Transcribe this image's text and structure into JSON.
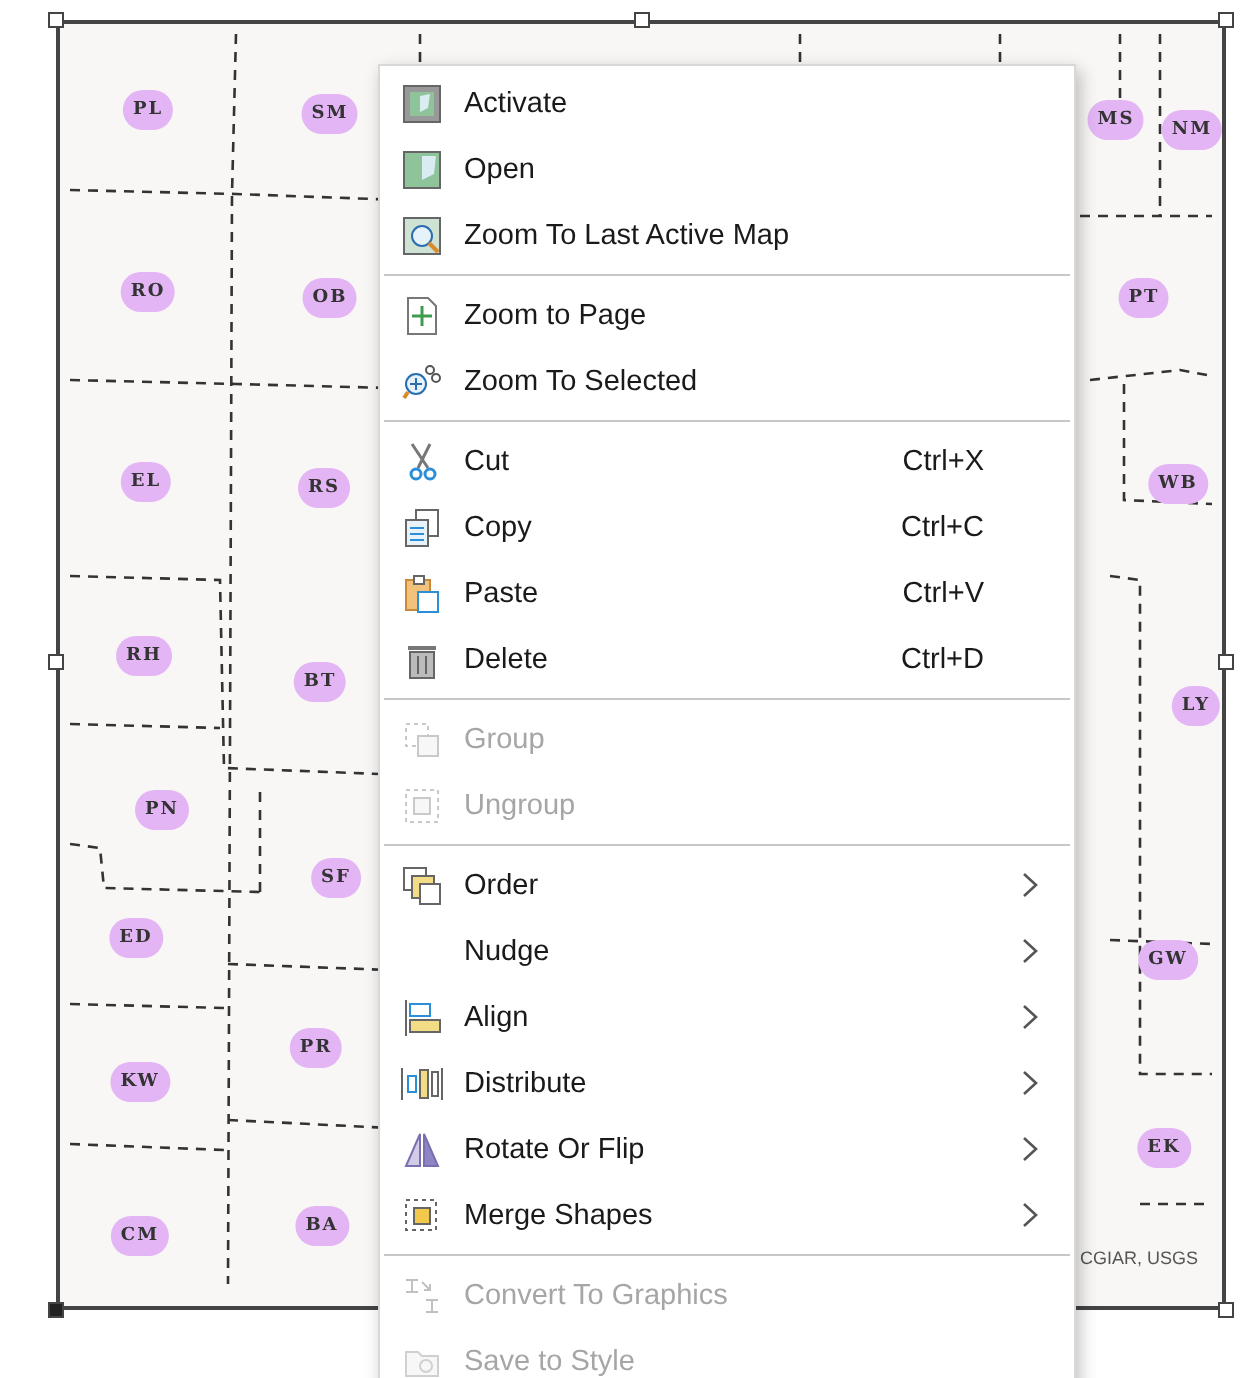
{
  "map": {
    "labels": [
      "PL",
      "SM",
      "MS",
      "NM",
      "RO",
      "OB",
      "PT",
      "EL",
      "RS",
      "WB",
      "RH",
      "BT",
      "LY",
      "PN",
      "SF",
      "ED",
      "GW",
      "PR",
      "KW",
      "EK",
      "CM",
      "BA"
    ],
    "attribution": "CGIAR, USGS"
  },
  "context_menu": {
    "sections": [
      [
        {
          "label": "Activate",
          "disabled": false,
          "submenu": false
        },
        {
          "label": "Open",
          "disabled": false,
          "submenu": false
        },
        {
          "label": "Zoom To Last Active Map",
          "disabled": false,
          "submenu": false
        }
      ],
      [
        {
          "label": "Zoom to Page",
          "disabled": false,
          "submenu": false
        },
        {
          "label": "Zoom To Selected",
          "disabled": false,
          "submenu": false
        }
      ],
      [
        {
          "label": "Cut",
          "shortcut": "Ctrl+X",
          "disabled": false,
          "submenu": false
        },
        {
          "label": "Copy",
          "shortcut": "Ctrl+C",
          "disabled": false,
          "submenu": false
        },
        {
          "label": "Paste",
          "shortcut": "Ctrl+V",
          "disabled": false,
          "submenu": false
        },
        {
          "label": "Delete",
          "shortcut": "Ctrl+D",
          "disabled": false,
          "submenu": false
        }
      ],
      [
        {
          "label": "Group",
          "disabled": true,
          "submenu": false
        },
        {
          "label": "Ungroup",
          "disabled": true,
          "submenu": false
        }
      ],
      [
        {
          "label": "Order",
          "disabled": false,
          "submenu": true
        },
        {
          "label": "Nudge",
          "disabled": false,
          "submenu": true
        },
        {
          "label": "Align",
          "disabled": false,
          "submenu": true
        },
        {
          "label": "Distribute",
          "disabled": false,
          "submenu": true
        },
        {
          "label": "Rotate Or Flip",
          "disabled": false,
          "submenu": true
        },
        {
          "label": "Merge Shapes",
          "disabled": false,
          "submenu": true
        }
      ],
      [
        {
          "label": "Convert To Graphics",
          "disabled": true,
          "submenu": false
        },
        {
          "label": "Save to Style",
          "disabled": true,
          "submenu": false
        }
      ]
    ]
  }
}
